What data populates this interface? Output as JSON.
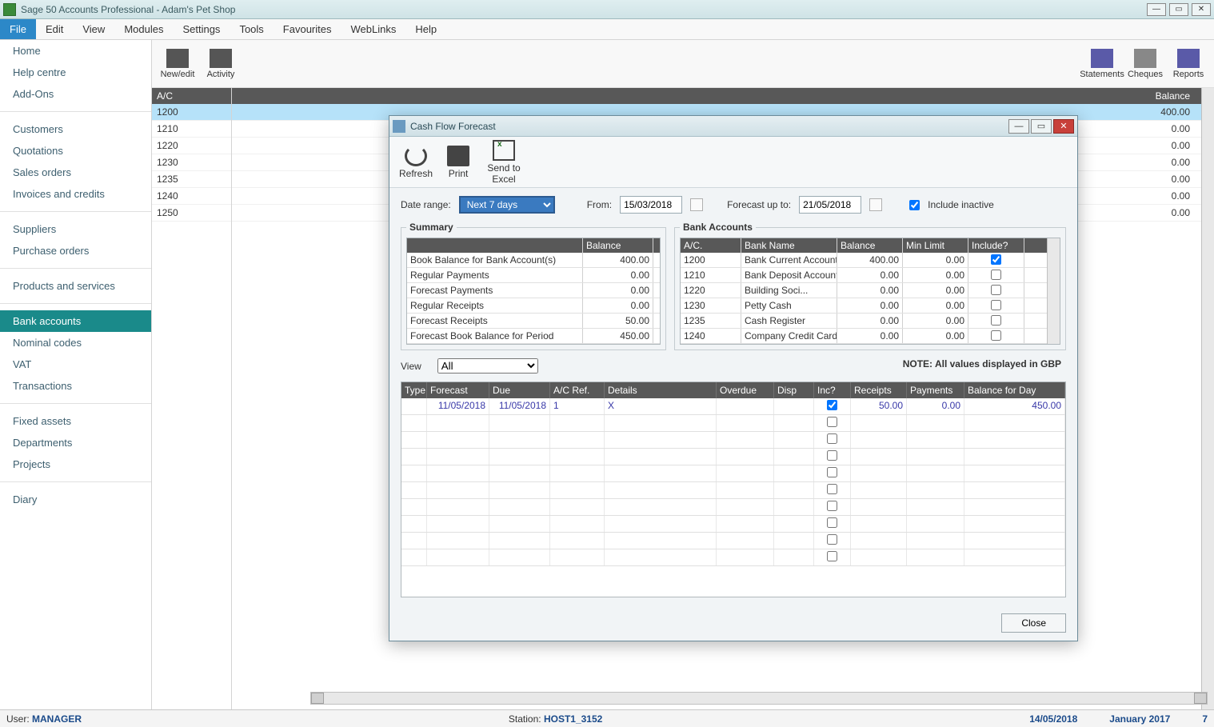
{
  "titlebar": {
    "title": "Sage 50 Accounts Professional - Adam's Pet Shop"
  },
  "menu": [
    "File",
    "Edit",
    "View",
    "Modules",
    "Settings",
    "Tools",
    "Favourites",
    "WebLinks",
    "Help"
  ],
  "menu_active": "File",
  "sidebar": {
    "g1": [
      "Home",
      "Help centre",
      "Add-Ons"
    ],
    "g2": [
      "Customers",
      "Quotations",
      "Sales orders",
      "Invoices and credits"
    ],
    "g3": [
      "Suppliers",
      "Purchase orders"
    ],
    "g4": [
      "Products and services"
    ],
    "g5": [
      "Bank accounts",
      "Nominal codes",
      "VAT",
      "Transactions"
    ],
    "g6": [
      "Fixed assets",
      "Departments",
      "Projects"
    ],
    "g7": [
      "Diary"
    ],
    "active": "Bank accounts"
  },
  "ribbon_left": [
    {
      "label": "New/edit"
    },
    {
      "label": "Activity"
    }
  ],
  "ribbon_right": [
    {
      "label": "Statements"
    },
    {
      "label": "Cheques"
    },
    {
      "label": "Reports"
    }
  ],
  "include_inactive_label": "Include inactive",
  "bg_headers": {
    "ac": "A/C",
    "bal": "Balance"
  },
  "bg_rows": [
    {
      "ac": "1200",
      "bal": "400.00",
      "sel": true
    },
    {
      "ac": "1210",
      "bal": "0.00"
    },
    {
      "ac": "1220",
      "bal": "0.00"
    },
    {
      "ac": "1230",
      "bal": "0.00"
    },
    {
      "ac": "1235",
      "bal": "0.00"
    },
    {
      "ac": "1240",
      "bal": "0.00"
    },
    {
      "ac": "1250",
      "bal": "0.00"
    }
  ],
  "dialog": {
    "title": "Cash Flow Forecast",
    "toolbar": {
      "refresh": "Refresh",
      "print": "Print",
      "excel": "Send to Excel"
    },
    "date_range_label": "Date range:",
    "date_range_value": "Next 7 days",
    "from_label": "From:",
    "from_value": "15/03/2018",
    "to_label": "Forecast up to:",
    "to_value": "21/05/2018",
    "include_inactive": "Include inactive",
    "summary_legend": "Summary",
    "summary_head_bal": "Balance",
    "summary_rows": [
      {
        "label": "Book Balance for Bank Account(s)",
        "val": "400.00"
      },
      {
        "label": "Regular Payments",
        "val": "0.00"
      },
      {
        "label": "Forecast Payments",
        "val": "0.00"
      },
      {
        "label": "Regular Receipts",
        "val": "0.00"
      },
      {
        "label": "Forecast Receipts",
        "val": "50.00"
      },
      {
        "label": "Forecast Book Balance for Period",
        "val": "450.00"
      }
    ],
    "bank_legend": "Bank Accounts",
    "bank_head": {
      "ac": "A/C.",
      "name": "Bank Name",
      "bal": "Balance",
      "min": "Min Limit",
      "inc": "Include?"
    },
    "bank_rows": [
      {
        "ac": "1200",
        "name": "Bank Current Account",
        "bal": "400.00",
        "min": "0.00",
        "inc": true
      },
      {
        "ac": "1210",
        "name": "Bank Deposit Account",
        "bal": "0.00",
        "min": "0.00",
        "inc": false
      },
      {
        "ac": "1220",
        "name": "Building Soci...",
        "bal": "0.00",
        "min": "0.00",
        "inc": false
      },
      {
        "ac": "1230",
        "name": "Petty Cash",
        "bal": "0.00",
        "min": "0.00",
        "inc": false
      },
      {
        "ac": "1235",
        "name": "Cash Register",
        "bal": "0.00",
        "min": "0.00",
        "inc": false
      },
      {
        "ac": "1240",
        "name": "Company Credit Card",
        "bal": "0.00",
        "min": "0.00",
        "inc": false
      }
    ],
    "note": "NOTE: All values displayed in GBP",
    "view_label": "View",
    "view_value": "All",
    "det_head": [
      "Type",
      "Forecast",
      "Due",
      "A/C Ref.",
      "Details",
      "Overdue",
      "Disp",
      "Inc?",
      "Receipts",
      "Payments",
      "Balance for Day"
    ],
    "det_row": {
      "forecast": "11/05/2018",
      "due": "11/05/2018",
      "acref": "1",
      "details": "X",
      "inc": true,
      "receipts": "50.00",
      "payments": "0.00",
      "bal": "450.00"
    },
    "close_btn": "Close"
  },
  "status": {
    "user_label": "User:",
    "user": "MANAGER",
    "station_label": "Station:",
    "station": "HOST1_3152",
    "date": "14/05/2018",
    "cal": "January 2017",
    "n": "7"
  }
}
